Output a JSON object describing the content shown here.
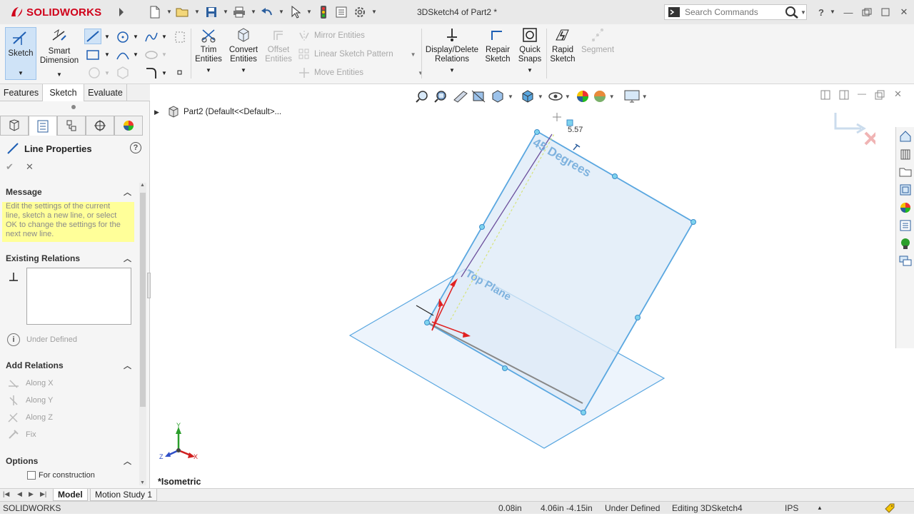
{
  "app": {
    "logo_text": "SOLIDWORKS",
    "document_title": "3DSketch4 of Part2 *",
    "brand_color": "#d0021b"
  },
  "search": {
    "placeholder": "Search Commands"
  },
  "ribbon": {
    "sketch": "Sketch",
    "smart_dimension_1": "Smart",
    "smart_dimension_2": "Dimension",
    "trim_1": "Trim",
    "trim_2": "Entities",
    "convert_1": "Convert",
    "convert_2": "Entities",
    "offset_1": "Offset",
    "offset_2": "Entities",
    "mirror": "Mirror Entities",
    "linear_pattern": "Linear Sketch Pattern",
    "move": "Move Entities",
    "display_delete_1": "Display/Delete",
    "display_delete_2": "Relations",
    "repair_1": "Repair",
    "repair_2": "Sketch",
    "quick_snaps_1": "Quick",
    "quick_snaps_2": "Snaps",
    "rapid_1": "Rapid",
    "rapid_2": "Sketch",
    "segment": "Segment"
  },
  "command_tabs": [
    "Features",
    "Sketch",
    "Evaluate"
  ],
  "property_manager": {
    "title": "Line Properties",
    "message_header": "Message",
    "message_lines": [
      "Edit the settings of the current",
      "line, sketch a new line, or select",
      "OK to change the settings for the",
      "next new line."
    ],
    "existing_relations_header": "Existing Relations",
    "status": "Under Defined",
    "add_relations_header": "Add Relations",
    "relations": [
      "Along X",
      "Along Y",
      "Along Z",
      "Fix"
    ],
    "options_header": "Options",
    "for_construction": "For construction"
  },
  "tree": {
    "root": "Part2  (Default<<Default>..."
  },
  "viewport": {
    "view_name": "*Isometric",
    "dimension_value": "5.57",
    "plane_label_1": "45 Degrees",
    "plane_label_2": "Top Plane",
    "triad": {
      "x": "X",
      "y": "Y",
      "z": "Z"
    },
    "plane_color": "#5aa7e0"
  },
  "bottom_tabs": [
    "Model",
    "Motion Study 1"
  ],
  "status_bar": {
    "app": "SOLIDWORKS",
    "length": "0.08in",
    "coords": "4.06in -4.15in",
    "state": "Under Defined",
    "editing": "Editing 3DSketch4",
    "units": "IPS"
  }
}
